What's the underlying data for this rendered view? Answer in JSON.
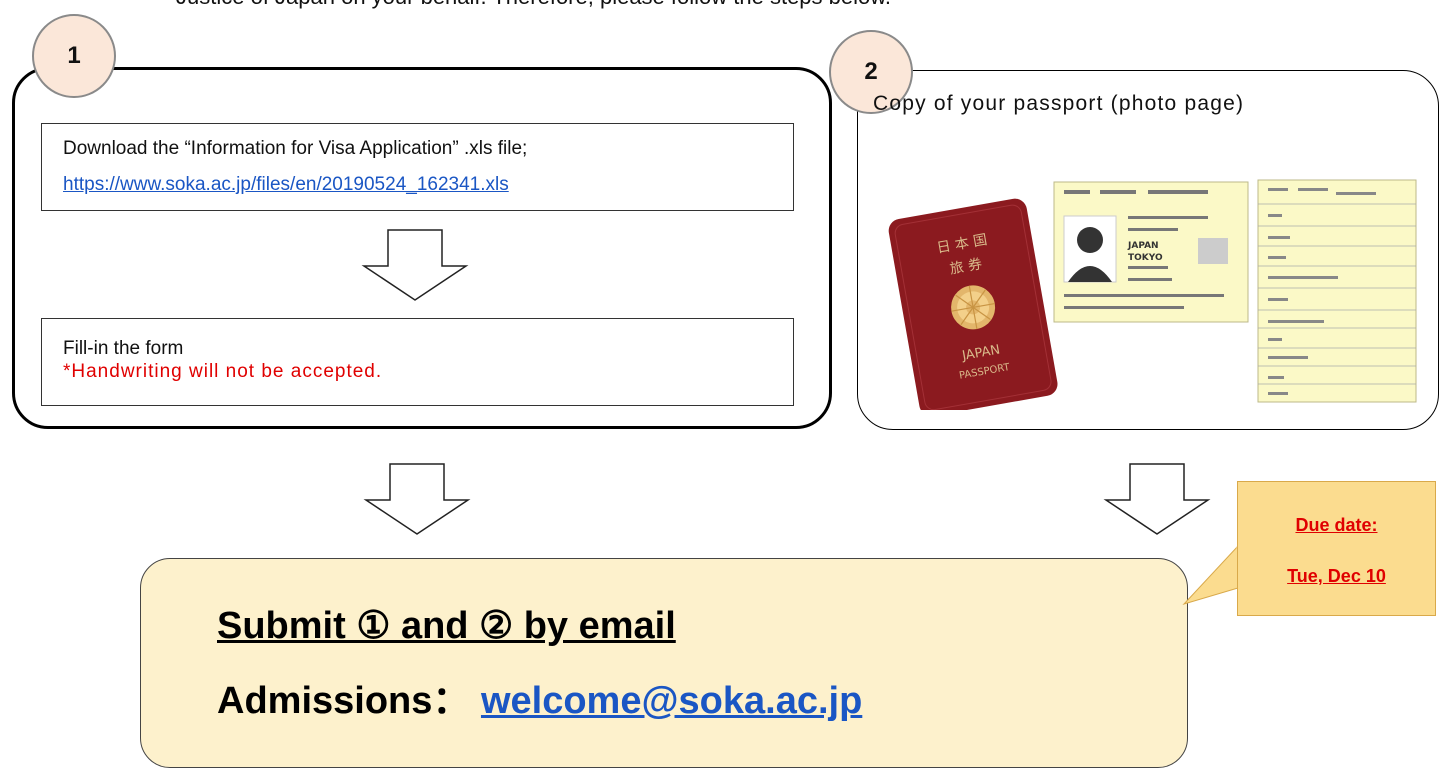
{
  "intro": "Justice of Japan on your behalf. Therefore, please follow the steps below.",
  "step1": {
    "badge": "1",
    "download_text": "Download the “Information for Visa Application” .xls file;",
    "download_link": "https://www.soka.ac.jp/files/en/20190524_162341.xls",
    "fill_text": "Fill-in the form",
    "warning": "*Handwriting will not be accepted."
  },
  "step2": {
    "badge": "2",
    "title": "Copy of your passport (photo page)",
    "passport_cover_text": [
      "日 本 国",
      "旅 券",
      "JAPAN",
      "PASSPORT"
    ],
    "passport_page_text": [
      "JAPAN",
      "TOKYO"
    ]
  },
  "submit": {
    "line1": "Submit ① and ② by email",
    "line2_label": "Admissions：",
    "email": "welcome@soka.ac.jp"
  },
  "due": {
    "label": "Due date:",
    "date": "Tue, Dec 10"
  },
  "colors": {
    "badge_fill": "#fbe7d9",
    "link": "#1a56c4",
    "warning": "#e00000",
    "submit_fill": "#fdf1cc",
    "note_fill": "#fbdc8f",
    "passport_cover": "#8b1a1f"
  }
}
